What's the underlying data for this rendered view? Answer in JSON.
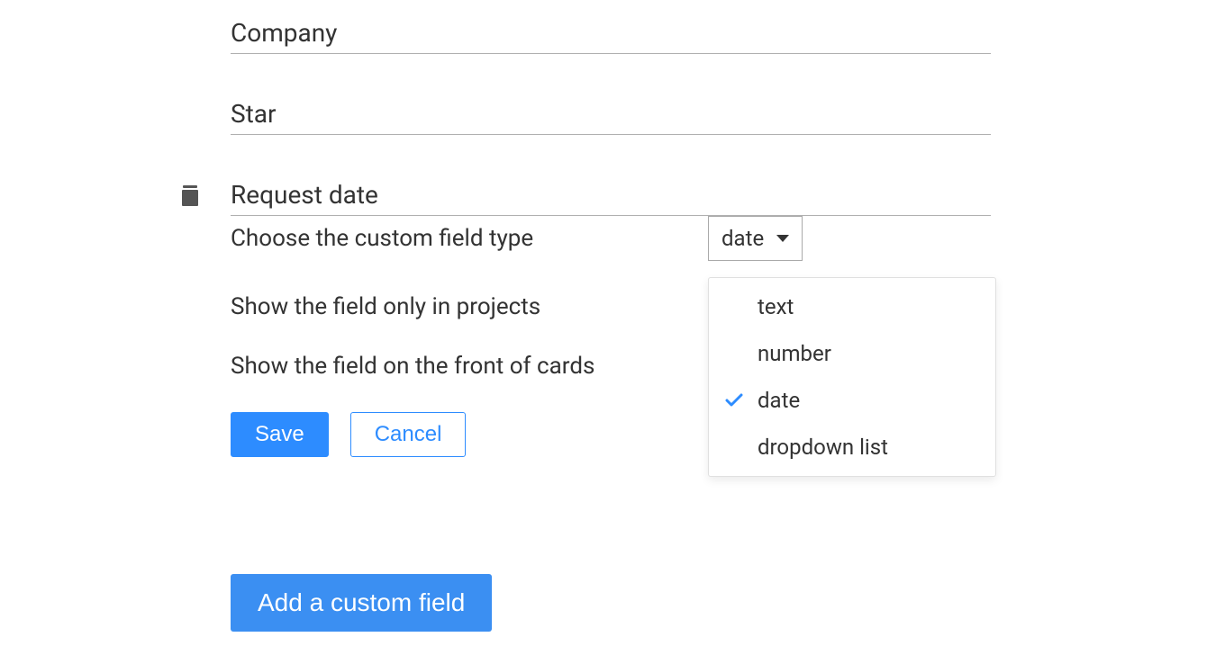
{
  "fields": [
    {
      "name": "Company",
      "has_trash": false
    },
    {
      "name": "Star",
      "has_trash": false
    },
    {
      "name": "Request date",
      "has_trash": true
    }
  ],
  "config": {
    "choose_type_label": "Choose the custom field type",
    "show_projects_label": "Show the field only in projects",
    "show_cards_label": "Show the field on the front of cards",
    "selected_type": "date",
    "type_options": [
      {
        "label": "text",
        "selected": false
      },
      {
        "label": "number",
        "selected": false
      },
      {
        "label": "date",
        "selected": true
      },
      {
        "label": "dropdown list",
        "selected": false
      }
    ]
  },
  "buttons": {
    "save": "Save",
    "cancel": "Cancel",
    "add_field": "Add a custom field"
  }
}
